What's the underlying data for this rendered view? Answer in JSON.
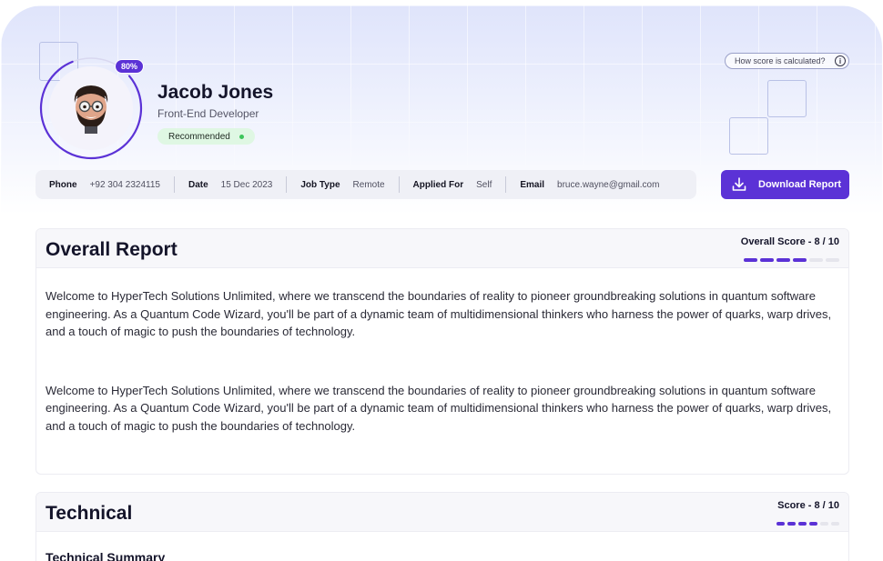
{
  "profile": {
    "name": "Jacob Jones",
    "role": "Front-End Developer",
    "status": "Recommended",
    "match_percent_label": "80%",
    "match_percent": 80
  },
  "header": {
    "how_score_label": "How score is calculated?",
    "download_label": "Download Report"
  },
  "info": {
    "phone_label": "Phone",
    "phone": "+92 304 2324115",
    "date_label": "Date",
    "date": "15 Dec 2023",
    "job_type_label": "Job Type",
    "job_type": "Remote",
    "applied_for_label": "Applied For",
    "applied_for": "Self",
    "email_label": "Email",
    "email": "bruce.wayne@gmail.com"
  },
  "overall": {
    "title": "Overall Report",
    "score_label": "Overall Score - 8 / 10",
    "score": 8,
    "score_max": 10,
    "paragraphs": [
      "Welcome to HyperTech Solutions Unlimited, where we transcend the boundaries of reality to pioneer groundbreaking solutions in quantum software engineering. As a Quantum Code Wizard, you'll be part of a dynamic team of multidimensional thinkers who harness the power of quarks, warp drives, and a touch of magic to push the boundaries of technology.",
      "Welcome to HyperTech Solutions Unlimited, where we transcend the boundaries of reality to pioneer groundbreaking solutions in quantum software engineering. As a Quantum Code Wizard, you'll be part of a dynamic team of multidimensional thinkers who harness the power of quarks, warp drives, and a touch of magic to push the boundaries of technology."
    ]
  },
  "technical": {
    "title": "Technical",
    "score_label": "Score - 8 / 10",
    "score": 8,
    "score_max": 10,
    "summary_title": "Technical Summary"
  },
  "colors": {
    "accent": "#5b32d6",
    "recommended_bg": "#dff7e3",
    "recommended_dot": "#3cc55a"
  },
  "icons": {
    "info": "info-icon",
    "download": "download-icon",
    "avatar": "avatar-memoji"
  }
}
